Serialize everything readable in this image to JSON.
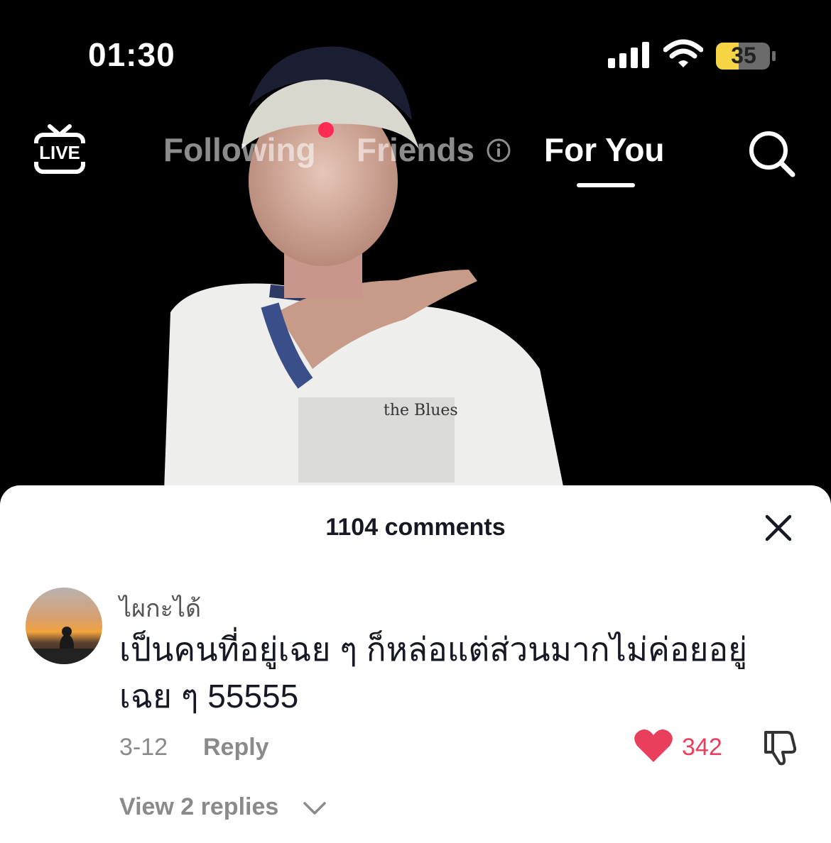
{
  "status_bar": {
    "time": "01:30",
    "battery": "35"
  },
  "top_nav": {
    "live_label": "LIVE",
    "tabs": [
      {
        "label": "Following"
      },
      {
        "label": "Friends"
      },
      {
        "label": "For You"
      }
    ]
  },
  "video": {
    "shirt_text": "the Blues"
  },
  "comments": {
    "title": "1104 comments",
    "items": [
      {
        "username": "ไผกะได้",
        "text": "เป็นคนที่อยู่เฉย ๆ ก็หล่อแต่ส่วนมากไม่ค่อยอยู่เฉย ๆ 55555",
        "date": "3-12",
        "reply_label": "Reply",
        "likes": "342",
        "view_replies": "View 2 replies"
      }
    ]
  },
  "colors": {
    "accent": "#fe2c55",
    "like": "#ea3e5d",
    "battery": "#f7d545"
  },
  "icons": [
    "live-tv-icon",
    "info-icon",
    "search-icon",
    "close-icon",
    "heart-icon",
    "dislike-icon",
    "chevron-down-icon"
  ]
}
